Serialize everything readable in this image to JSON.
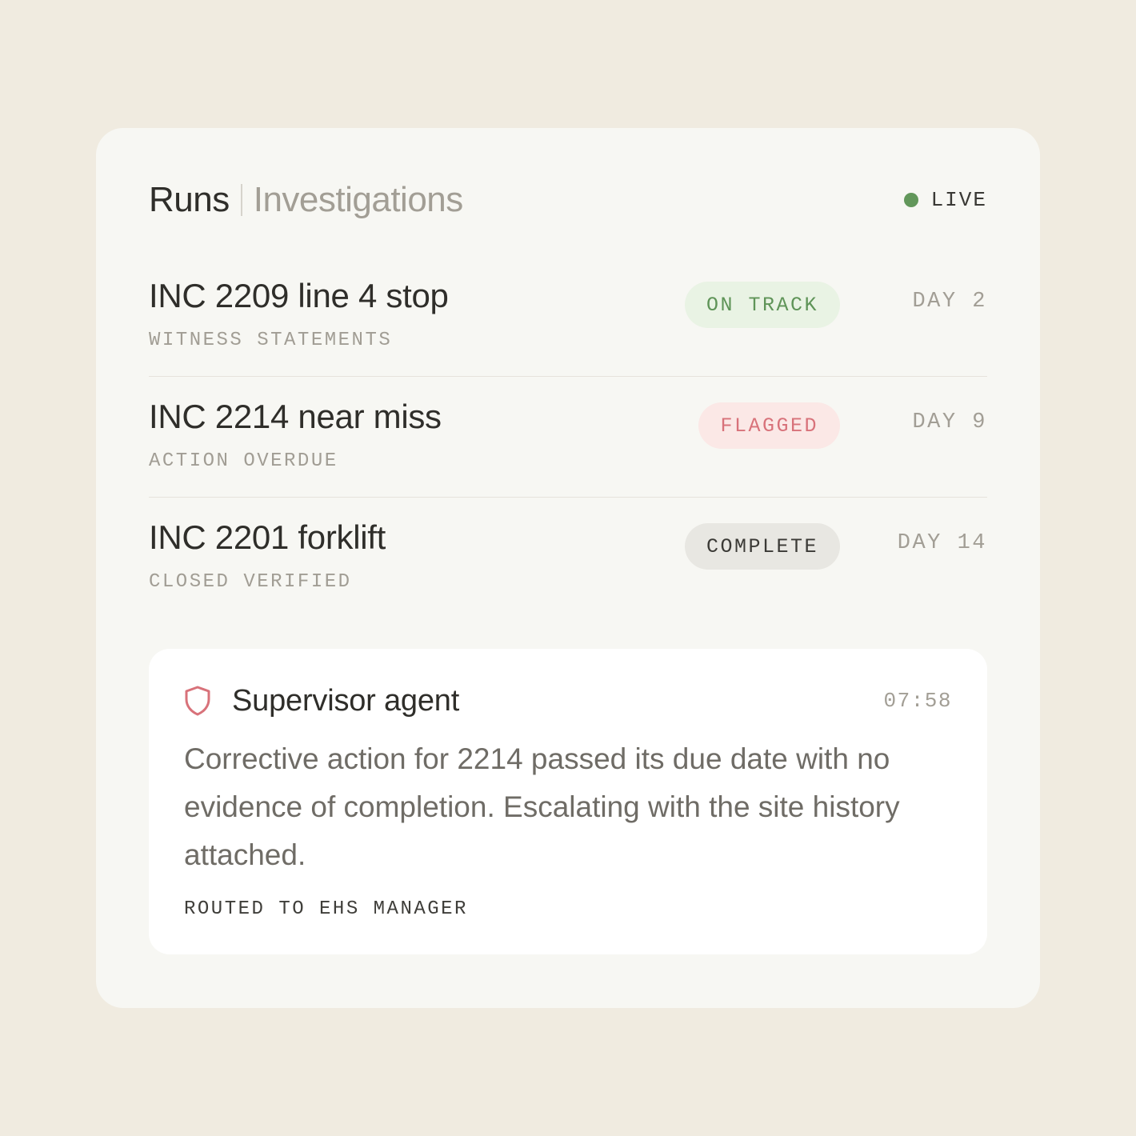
{
  "header": {
    "title": "Runs",
    "subtitle": "Investigations",
    "status_label": "LIVE",
    "status_color": "#62975a"
  },
  "runs": [
    {
      "name": "INC 2209 line 4 stop",
      "stage": "WITNESS STATEMENTS",
      "status": "ON TRACK",
      "status_kind": "ok",
      "day": "DAY 2"
    },
    {
      "name": "INC 2214 near miss",
      "stage": "ACTION OVERDUE",
      "status": "FLAGGED",
      "status_kind": "flag",
      "day": "DAY 9"
    },
    {
      "name": "INC 2201 forklift",
      "stage": "CLOSED VERIFIED",
      "status": "COMPLETE",
      "status_kind": "done",
      "day": "DAY 14"
    }
  ],
  "agent": {
    "icon": "shield-icon",
    "name": "Supervisor agent",
    "time": "07:58",
    "message": "Corrective action for 2214 passed its due date with no evidence of completion. Escalating with the site history attached.",
    "route": "ROUTED TO EHS MANAGER"
  },
  "colors": {
    "page_background": "#f0ebe0",
    "card_background": "#f7f7f3",
    "on_track": "#5f9458",
    "flagged": "#d8727a",
    "shield": "#d8727a"
  }
}
